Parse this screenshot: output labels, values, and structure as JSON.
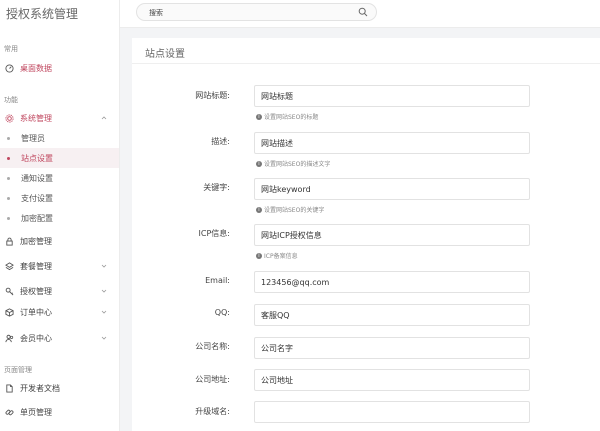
{
  "app": {
    "title": "授权系统管理"
  },
  "search": {
    "placeholder": "搜索"
  },
  "sidebar": {
    "section_common": "常用",
    "dashboard": "桌面数据",
    "section_function": "功能",
    "system_menu": "系统管理",
    "system_sub": [
      {
        "label": "管理员",
        "active": false
      },
      {
        "label": "站点设置",
        "active": true
      },
      {
        "label": "通知设置",
        "active": false
      },
      {
        "label": "支付设置",
        "active": false
      },
      {
        "label": "加密配置",
        "active": false
      }
    ],
    "encrypt_menu": "加密管理",
    "package_menu": "套餐管理",
    "auth_menu": "授权管理",
    "order_menu": "订单中心",
    "member_menu": "会员中心",
    "section_pages": "页面管理",
    "dev_docs": "开发者文档",
    "single_page": "单页管理"
  },
  "page": {
    "title": "站点设置"
  },
  "form": {
    "site_title": {
      "label": "网站标题:",
      "value": "网站标题",
      "hint": "设置网站SEO的标题"
    },
    "description": {
      "label": "描述:",
      "value": "网站描述",
      "hint": "设置网站SEO的描述文字"
    },
    "keywords": {
      "label": "关键字:",
      "value": "网站keyword",
      "hint": "设置网站SEO的关键字"
    },
    "icp": {
      "label": "ICP信息:",
      "value": "网站ICP授权信息",
      "hint": "ICP备案信息"
    },
    "email": {
      "label": "Email:",
      "value": "123456@qq.com"
    },
    "qq": {
      "label": "QQ:",
      "value": "客服QQ"
    },
    "company_name": {
      "label": "公司名称:",
      "value": "公司名字"
    },
    "company_address": {
      "label": "公司地址:",
      "value": "公司地址"
    },
    "upgrade_domain": {
      "label": "升级域名:",
      "value": ""
    }
  },
  "colors": {
    "accent": "#c0475f",
    "background": "#f3f4f6"
  }
}
